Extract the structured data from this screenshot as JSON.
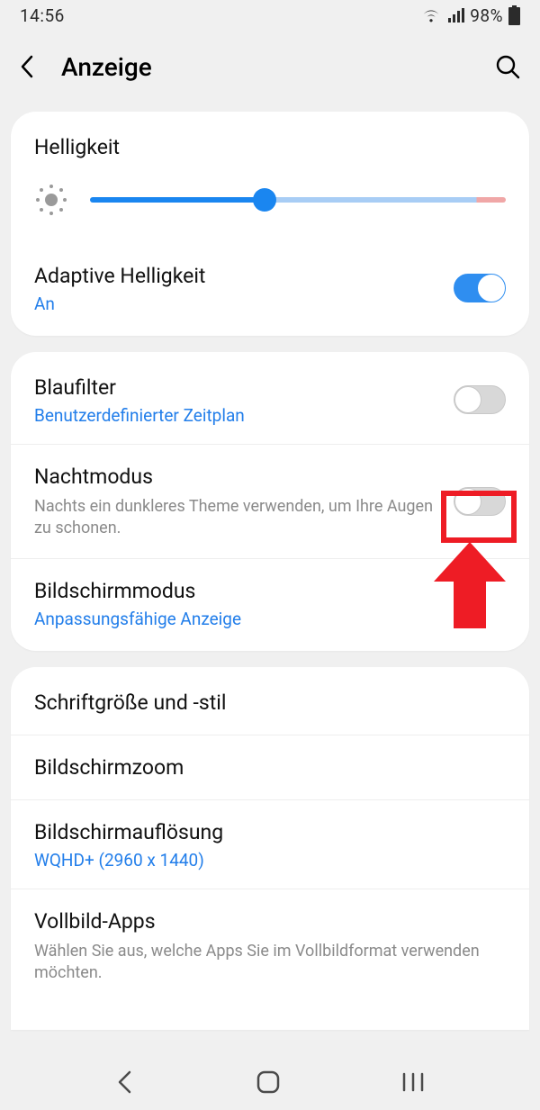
{
  "statusbar": {
    "time": "14:56",
    "battery_pct": "98%"
  },
  "header": {
    "title": "Anzeige"
  },
  "brightness": {
    "heading": "Helligkeit",
    "slider_percent": 42
  },
  "adaptive": {
    "title": "Adaptive Helligkeit",
    "state_label": "An",
    "on": true
  },
  "bluefilter": {
    "title": "Blaufilter",
    "sub": "Benutzerdefinierter Zeitplan",
    "on": false
  },
  "nightmode": {
    "title": "Nachtmodus",
    "sub": "Nachts ein dunkleres Theme verwenden, um Ihre Augen zu schonen.",
    "on": false
  },
  "screenmode": {
    "title": "Bildschirmmodus",
    "sub": "Anpassungsfähige Anzeige"
  },
  "font": {
    "title": "Schriftgröße und -stil"
  },
  "zoom": {
    "title": "Bildschirmzoom"
  },
  "resolution": {
    "title": "Bildschirmauflösung",
    "sub": "WQHD+ (2960 x 1440)"
  },
  "fullscreen": {
    "title": "Vollbild-Apps",
    "sub": "Wählen Sie aus, welche Apps Sie im Vollbildformat verwenden möchten."
  },
  "annotation": {
    "highlight_target": "nightmode-toggle"
  }
}
